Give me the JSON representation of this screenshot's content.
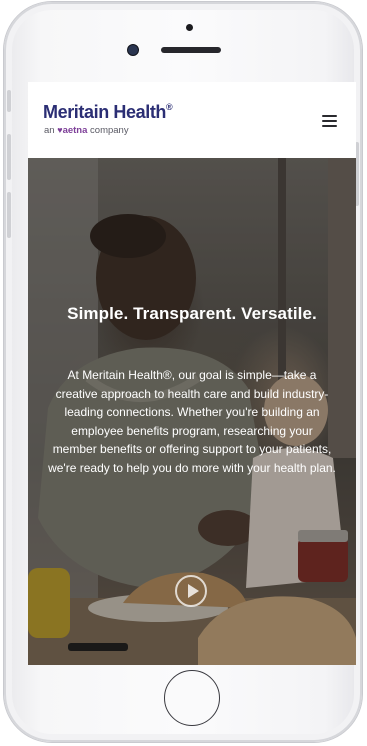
{
  "header": {
    "logo_text": "Meritain Health",
    "logo_reg": "®",
    "tagline_prefix": "an",
    "tagline_brand": "aetna",
    "tagline_suffix": "company"
  },
  "hero": {
    "title": "Simple. Transparent. Versatile.",
    "body": "At Meritain Health®, our goal is simple—take a creative approach to health care and build industry-leading connections. Whether you're building an employee benefits program, researching your member benefits or offering support to your patients, we're ready to help you do more with your health plan."
  },
  "icons": {
    "menu": "hamburger-menu-icon",
    "play": "play-icon",
    "heart": "heart-icon"
  },
  "colors": {
    "brand_navy": "#2b2e74",
    "aetna_purple": "#7d3f98"
  }
}
